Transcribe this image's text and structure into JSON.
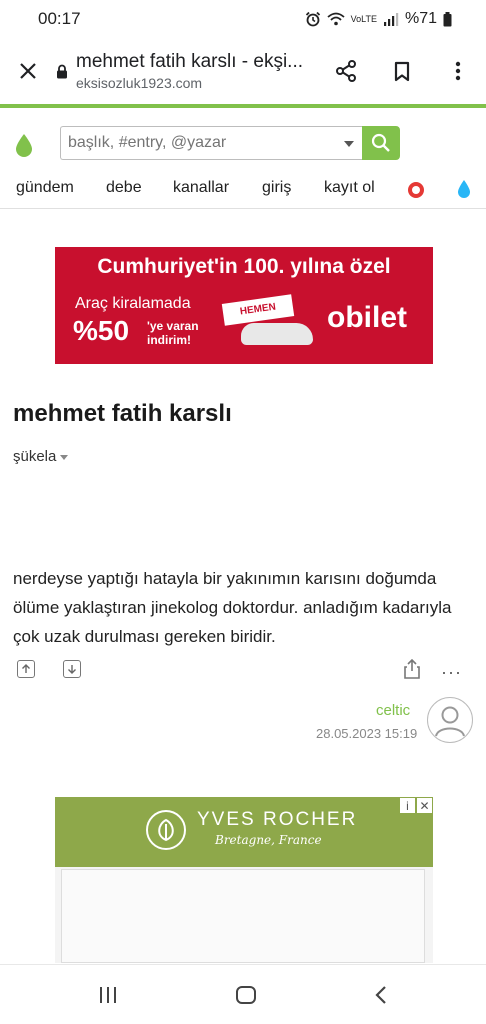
{
  "status_bar": {
    "time": "00:17",
    "network": "VoLTE",
    "battery": "%71"
  },
  "browser": {
    "page_title": "mehmet fatih karslı - ekşi...",
    "url": "eksisozluk1923.com"
  },
  "search": {
    "placeholder": "başlık, #entry, @yazar"
  },
  "nav": {
    "items": [
      "gündem",
      "debe",
      "kanallar",
      "giriş",
      "kayıt ol"
    ]
  },
  "ad1": {
    "headline": "Cumhuriyet'in 100. yılına özel",
    "line1": "Araç kiralamada",
    "percent": "%50",
    "line2a": "'ye varan",
    "line2b": "indirim!",
    "badge": "HEMEN KİRALA",
    "brand": "obilet"
  },
  "entry": {
    "title": "mehmet fatih karslı",
    "sort": "şükela",
    "text": "nerdeyse yaptığı hatayla bir yakınımın karısını doğumda ölüme yaklaştıran jinekolog doktordur. anladığım kadarıyla çok uzak durulması gereken biridir.",
    "author": "celtic",
    "date": "28.05.2023 15:19",
    "more": "···"
  },
  "ad2": {
    "brand": "YVES ROCHER",
    "tagline": "Bretagne, France",
    "info": "i",
    "close": "✕"
  },
  "colors": {
    "accent": "#81c14b",
    "ad1_bg": "#c8102e",
    "ad2_bg": "#8ea84a"
  }
}
